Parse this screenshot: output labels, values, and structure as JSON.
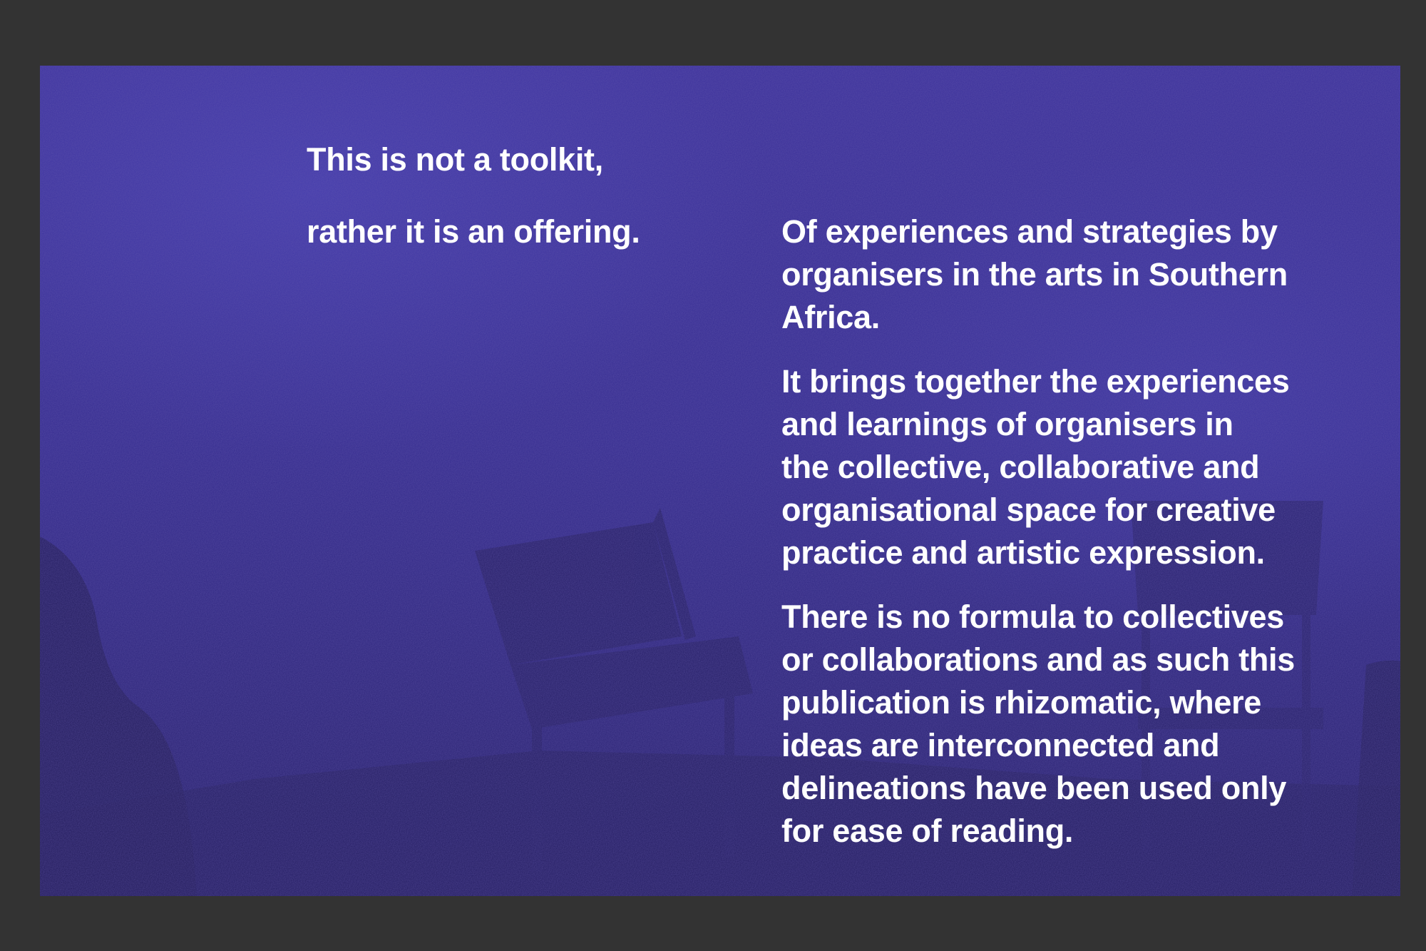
{
  "page": {
    "heading_line1": "This is not a toolkit,",
    "heading_line2": "rather it is an offering.",
    "paragraphs": [
      "Of experiences and strategies by\norganisers in the arts in Southern\nAfrica.",
      "It brings together the experiences\nand learnings of organisers in\nthe collective, collaborative and\norganisational space for creative\npractice and artistic expression.",
      "There is no formula to collectives\nor collaborations and as such this\npublication is rhizomatic, where\nideas are interconnected and\ndelineations have been used only\nfor ease of reading."
    ]
  },
  "colors": {
    "viewer_background": "#333333",
    "page_tint": "#332a8e",
    "text": "#ffffff"
  }
}
